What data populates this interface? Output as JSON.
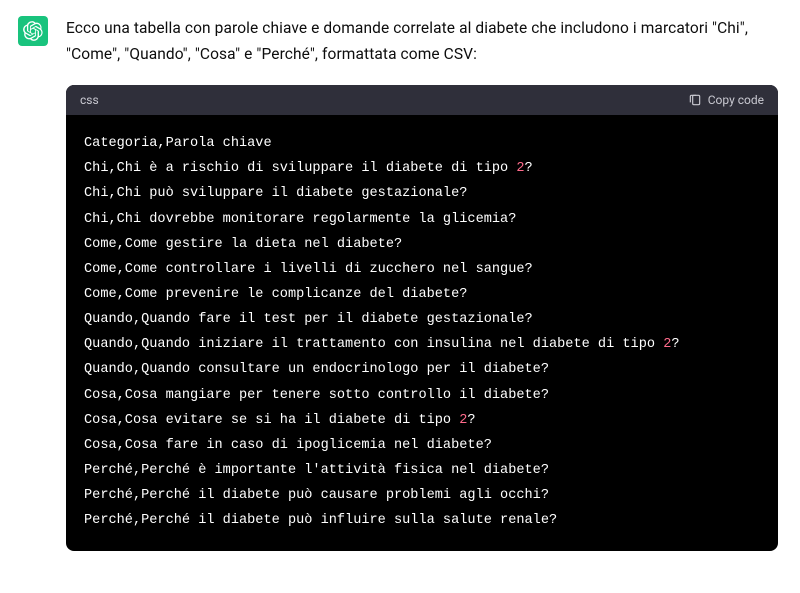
{
  "message": {
    "intro": "Ecco una tabella con parole chiave e domande correlate al diabete che includono i marcatori \"Chi\", \"Come\", \"Quando\", \"Cosa\" e \"Perché\", formattata come CSV:"
  },
  "codeblock": {
    "lang_label": "css",
    "copy_label": "Copy code",
    "lines": [
      [
        {
          "t": "Categoria,Parola chiave"
        }
      ],
      [
        {
          "t": "Chi,Chi è a rischio di sviluppare il diabete di tipo "
        },
        {
          "t": "2",
          "c": "num"
        },
        {
          "t": "?"
        }
      ],
      [
        {
          "t": "Chi,Chi può sviluppare il diabete gestazionale?"
        }
      ],
      [
        {
          "t": "Chi,Chi dovrebbe monitorare regolarmente la glicemia?"
        }
      ],
      [
        {
          "t": "Come,Come gestire la dieta nel diabete?"
        }
      ],
      [
        {
          "t": "Come,Come controllare i livelli di zucchero nel sangue?"
        }
      ],
      [
        {
          "t": "Come,Come prevenire le complicanze del diabete?"
        }
      ],
      [
        {
          "t": "Quando,Quando fare il test per il diabete gestazionale?"
        }
      ],
      [
        {
          "t": "Quando,Quando iniziare il trattamento con insulina nel diabete di tipo "
        },
        {
          "t": "2",
          "c": "num"
        },
        {
          "t": "?"
        }
      ],
      [
        {
          "t": "Quando,Quando consultare un endocrinologo per il diabete?"
        }
      ],
      [
        {
          "t": "Cosa,Cosa mangiare per tenere sotto controllo il diabete?"
        }
      ],
      [
        {
          "t": "Cosa,Cosa evitare se si ha il diabete di tipo "
        },
        {
          "t": "2",
          "c": "num"
        },
        {
          "t": "?"
        }
      ],
      [
        {
          "t": "Cosa,Cosa fare in caso di ipoglicemia nel diabete?"
        }
      ],
      [
        {
          "t": "Perché,Perché è importante l'attività fisica nel diabete?"
        }
      ],
      [
        {
          "t": "Perché,Perché il diabete può causare problemi agli occhi?"
        }
      ],
      [
        {
          "t": "Perché,Perché il diabete può influire sulla salute renale?"
        }
      ]
    ]
  }
}
